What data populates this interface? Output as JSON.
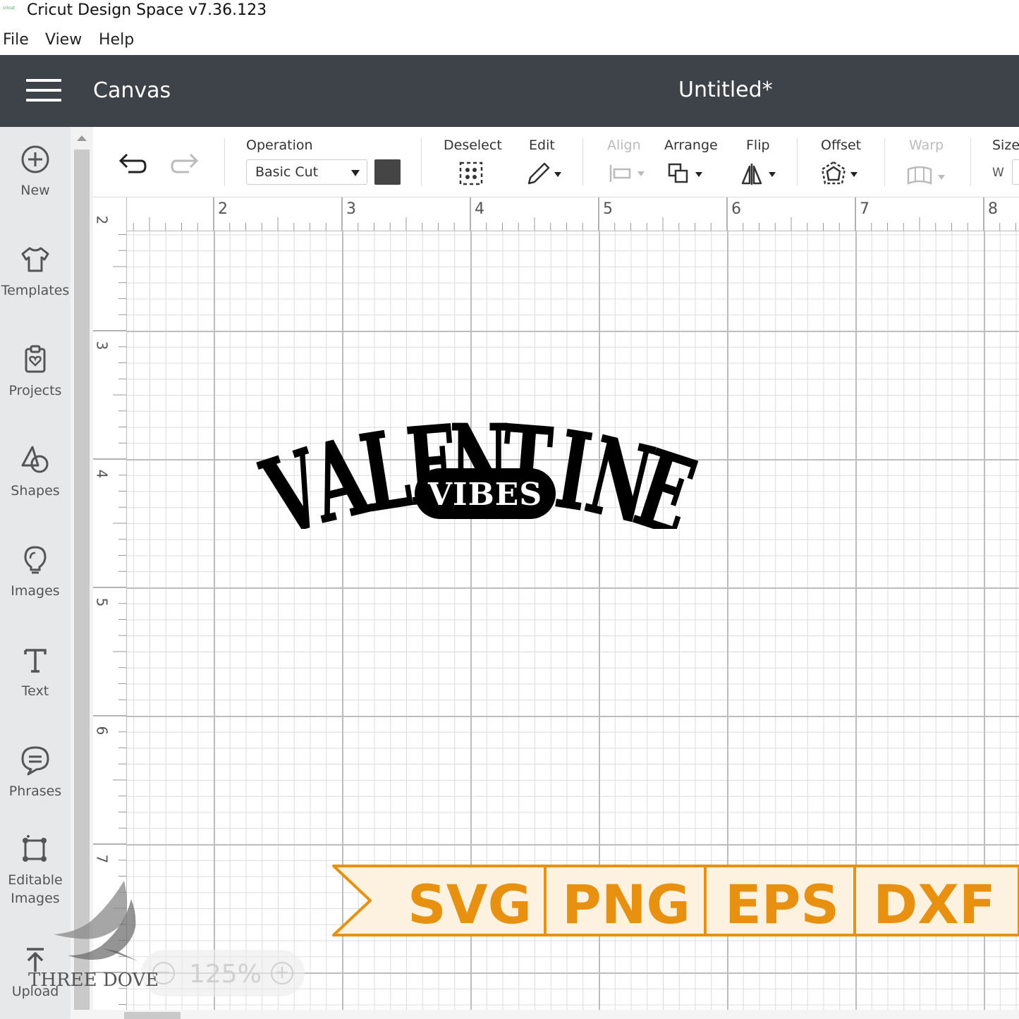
{
  "window": {
    "app_title": "Cricut Design Space  v7.36.123",
    "app_icon_text": "cricut"
  },
  "menu": {
    "items": [
      "File",
      "View",
      "Help"
    ]
  },
  "header": {
    "section": "Canvas",
    "document_title": "Untitled*"
  },
  "sidebar": {
    "items": [
      {
        "label": "New",
        "icon": "plus-circle-icon"
      },
      {
        "label": "Templates",
        "icon": "tshirt-icon"
      },
      {
        "label": "Projects",
        "icon": "clipboard-heart-icon"
      },
      {
        "label": "Shapes",
        "icon": "shapes-icon"
      },
      {
        "label": "Images",
        "icon": "lightbulb-icon"
      },
      {
        "label": "Text",
        "icon": "text-t-icon"
      },
      {
        "label": "Phrases",
        "icon": "speech-bubble-icon"
      },
      {
        "label": "Editable\nImages",
        "label_line1": "Editable",
        "label_line2": "Images",
        "icon": "editable-images-icon"
      },
      {
        "label": "Upload",
        "icon": "upload-icon"
      }
    ]
  },
  "toolbar": {
    "operation_label": "Operation",
    "operation_value": "Basic Cut",
    "operation_color": "#454545",
    "deselect_label": "Deselect",
    "edit_label": "Edit",
    "align_label": "Align",
    "arrange_label": "Arrange",
    "flip_label": "Flip",
    "offset_label": "Offset",
    "warp_label": "Warp",
    "size_label": "Size",
    "size_w_label": "W"
  },
  "ruler": {
    "top_numbers": [
      "2",
      "3",
      "4",
      "5",
      "6",
      "7",
      "8"
    ],
    "left_numbers": [
      "2",
      "3",
      "4",
      "5",
      "6",
      "7"
    ]
  },
  "design": {
    "main_text": "VALENTINE",
    "sub_text": "VIBES"
  },
  "formats": {
    "items": [
      "SVG",
      "PNG",
      "EPS",
      "DXF"
    ],
    "accent": "#e8900f",
    "background": "#fdf1df"
  },
  "zoom": {
    "value": "125%",
    "minus": "−",
    "plus": "+"
  },
  "watermark": {
    "text": "THREE DOVE"
  }
}
